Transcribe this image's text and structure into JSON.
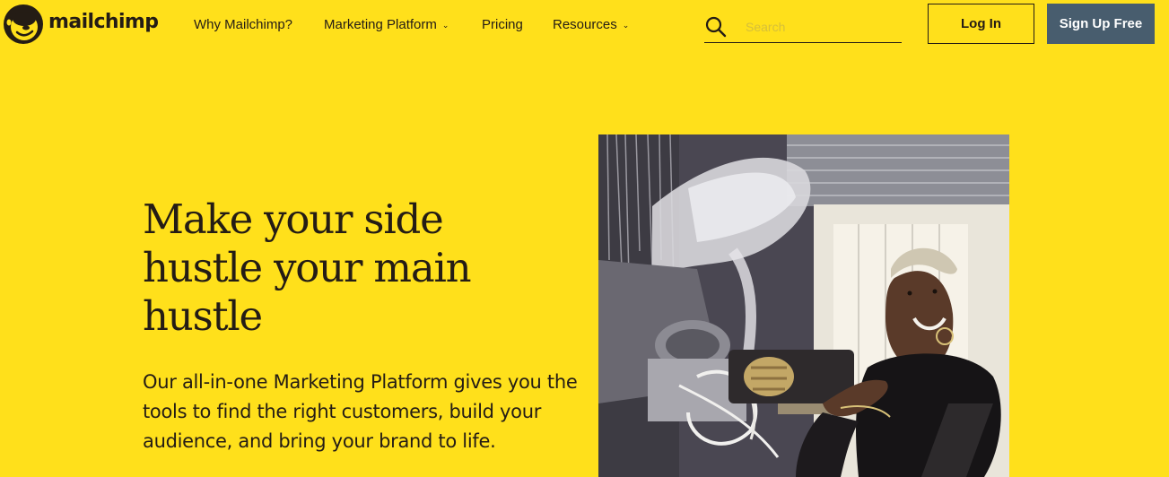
{
  "brand": {
    "name": "mailchimp"
  },
  "nav": {
    "items": [
      {
        "label": "Why Mailchimp?",
        "has_dropdown": false
      },
      {
        "label": "Marketing Platform",
        "has_dropdown": true
      },
      {
        "label": "Pricing",
        "has_dropdown": false
      },
      {
        "label": "Resources",
        "has_dropdown": true
      }
    ],
    "caret": "⌄"
  },
  "search": {
    "placeholder": "Search",
    "value": ""
  },
  "auth": {
    "login_label": "Log In",
    "signup_label": "Sign Up Free"
  },
  "hero": {
    "headline": "Make your side hustle your main hustle",
    "subcopy": "Our all-in-one Marketing Platform gives you the tools to find the right customers, build your audience, and bring your brand to life.",
    "image_alt": "Woman smiling while working in a workshop"
  },
  "colors": {
    "background": "#FFE01B",
    "text": "#241c15",
    "signup_button": "#485d6e"
  }
}
